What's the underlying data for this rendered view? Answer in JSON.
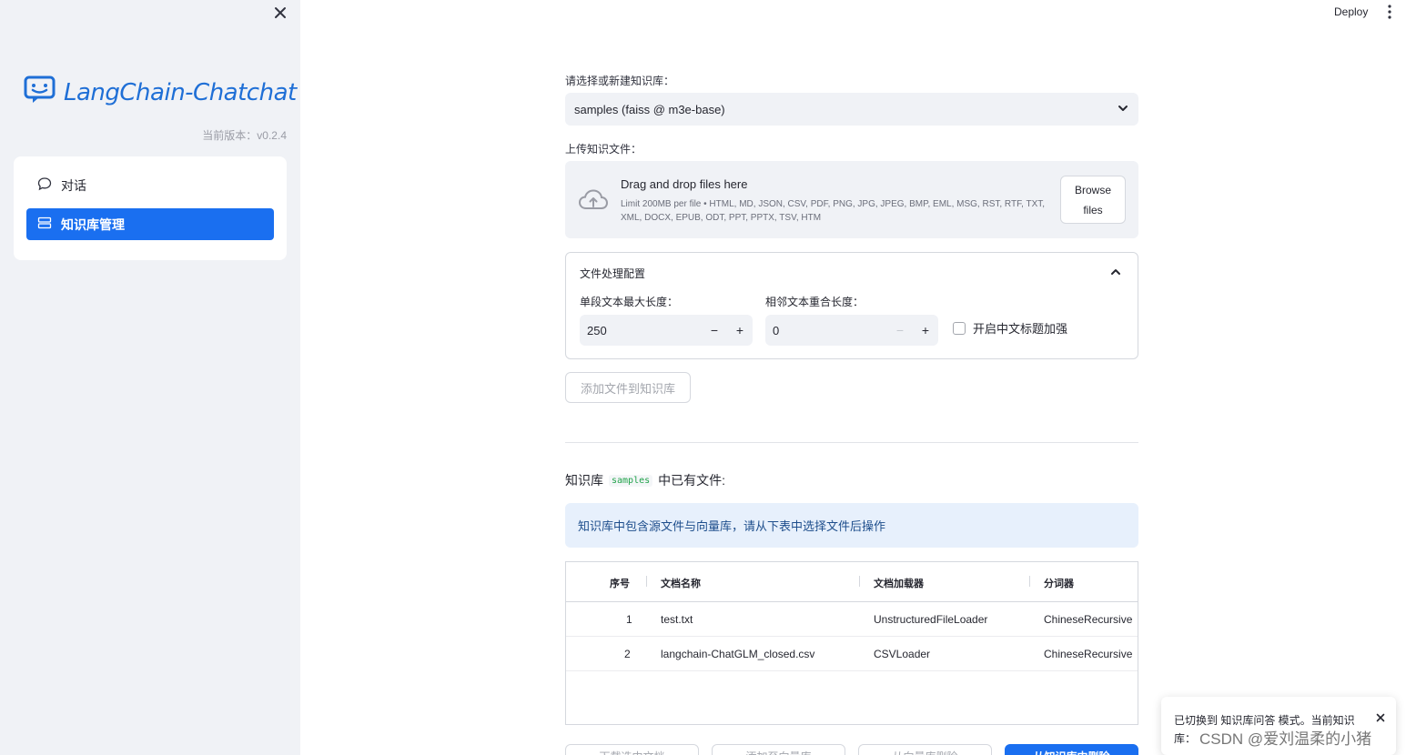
{
  "sidebar": {
    "app_name": "LangChain-Chatchat",
    "version": "当前版本：v0.2.4",
    "nav": [
      {
        "label": "对话"
      },
      {
        "label": "知识库管理"
      }
    ]
  },
  "header": {
    "deploy_label": "Deploy"
  },
  "main": {
    "kb_select_label": "请选择或新建知识库：",
    "kb_select_value": "samples (faiss @ m3e-base)",
    "upload_label": "上传知识文件：",
    "uploader": {
      "title": "Drag and drop files here",
      "limit": "Limit 200MB per file • HTML, MD, JSON, CSV, PDF, PNG, JPG, JPEG, BMP, EML, MSG, RST, RTF, TXT, XML, DOCX, EPUB, ODT, PPT, PPTX, TSV, HTM",
      "browse_line1": "Browse",
      "browse_line2": "files"
    },
    "config": {
      "title": "文件处理配置",
      "chunk_size_label": "单段文本最大长度：",
      "chunk_size_value": "250",
      "overlap_label": "相邻文本重合长度：",
      "overlap_value": "0",
      "zh_title_label": "开启中文标题加强"
    },
    "add_button": "添加文件到知识库",
    "kb_files_prefix": "知识库",
    "kb_files_name": "samples",
    "kb_files_suffix": "中已有文件:",
    "info_text": "知识库中包含源文件与向量库，请从下表中选择文件后操作",
    "table": {
      "columns": [
        "序号",
        "文档名称",
        "文档加载器",
        "分词器"
      ],
      "rows": [
        {
          "no": "1",
          "name": "test.txt",
          "loader": "UnstructuredFileLoader",
          "splitter": "ChineseRecursive"
        },
        {
          "no": "2",
          "name": "langchain-ChatGLM_closed.csv",
          "loader": "CSVLoader",
          "splitter": "ChineseRecursive"
        }
      ]
    },
    "bottom_buttons": [
      "下载选中文档",
      "添加至向量库",
      "从向量库删除",
      "从知识库中删除"
    ]
  },
  "toast": {
    "line1": "已切换到 知识库问答 模式。当前知识",
    "line2": "库："
  },
  "watermark": "CSDN @爱刘温柔的小猪",
  "colors": {
    "accent": "#1a6ff0",
    "sidebar_bg": "#f0f2f6",
    "info_bg": "#e7f0fc",
    "logo": "#1f6fd6"
  }
}
